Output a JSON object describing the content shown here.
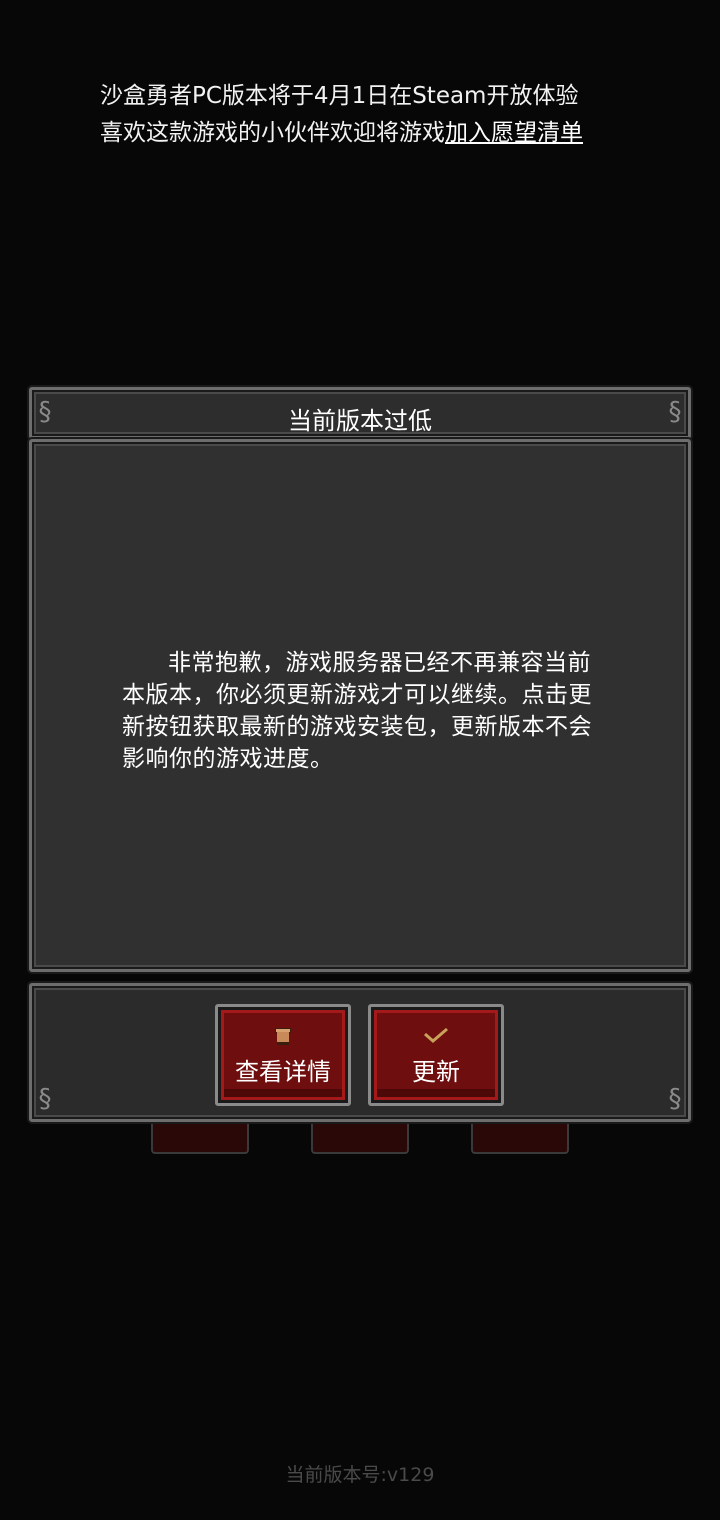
{
  "announcement": {
    "line1": "沙盒勇者PC版本将于4月1日在Steam开放体验",
    "line2_prefix": "喜欢这款游戏的小伙伴欢迎将游戏",
    "line2_link": "加入愿望清单"
  },
  "dialog": {
    "title": "当前版本过低",
    "message": "非常抱歉，游戏服务器已经不再兼容当前本版本，你必须更新游戏才可以继续。点击更新按钮获取最新的游戏安装包，更新版本不会影响你的游戏进度。",
    "buttons": {
      "detail": {
        "label": "查看详情",
        "icon": "scroll-icon"
      },
      "update": {
        "label": "更新",
        "icon": "checkmark-icon"
      }
    }
  },
  "footer": {
    "version": "当前版本号:v129"
  },
  "colors": {
    "background": "#070707",
    "panel": "#2b2b2b",
    "button_red": "#6e0e0e",
    "icon_gold": "#c9a15a"
  }
}
